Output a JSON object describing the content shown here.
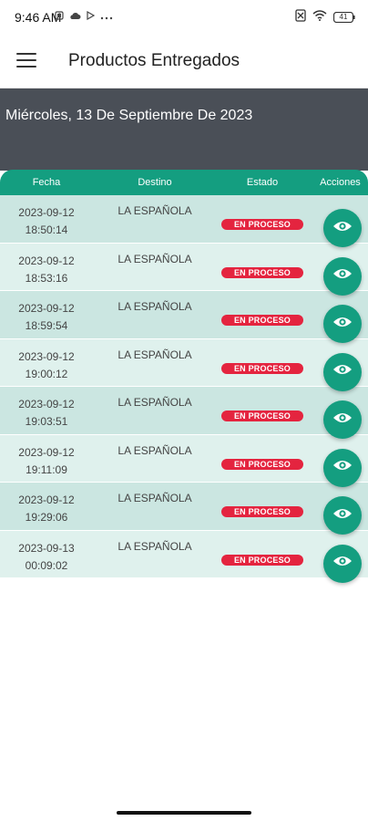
{
  "status_bar": {
    "time": "9:46 AM",
    "battery": "41"
  },
  "app_bar": {
    "title": "Productos Entregados",
    "menu_icon": "hamburger-menu-icon"
  },
  "date_banner": {
    "text": "Miércoles, 13 De Septiembre De 2023"
  },
  "table": {
    "headers": {
      "fecha": "Fecha",
      "destino": "Destino",
      "estado": "Estado",
      "acciones": "Acciones"
    },
    "rows": [
      {
        "date": "2023-09-12",
        "time": "18:50:14",
        "destino": "LA ESPAÑOLA",
        "estado": "EN PROCESO"
      },
      {
        "date": "2023-09-12",
        "time": "18:53:16",
        "destino": "LA ESPAÑOLA",
        "estado": "EN PROCESO"
      },
      {
        "date": "2023-09-12",
        "time": "18:59:54",
        "destino": "LA ESPAÑOLA",
        "estado": "EN PROCESO"
      },
      {
        "date": "2023-09-12",
        "time": "19:00:12",
        "destino": "LA ESPAÑOLA",
        "estado": "EN PROCESO"
      },
      {
        "date": "2023-09-12",
        "time": "19:03:51",
        "destino": "LA ESPAÑOLA",
        "estado": "EN PROCESO"
      },
      {
        "date": "2023-09-12",
        "time": "19:11:09",
        "destino": "LA ESPAÑOLA",
        "estado": "EN PROCESO"
      },
      {
        "date": "2023-09-12",
        "time": "19:29:06",
        "destino": "LA ESPAÑOLA",
        "estado": "EN PROCESO"
      },
      {
        "date": "2023-09-13",
        "time": "00:09:02",
        "destino": "LA ESPAÑOLA",
        "estado": "EN PROCESO"
      }
    ],
    "action_icon": "eye-icon"
  },
  "colors": {
    "accent": "#149e80",
    "banner": "#4a4f57",
    "row_dark": "#cbe6e1",
    "row_light": "#dff1ed",
    "status_badge": "#e4243f"
  }
}
